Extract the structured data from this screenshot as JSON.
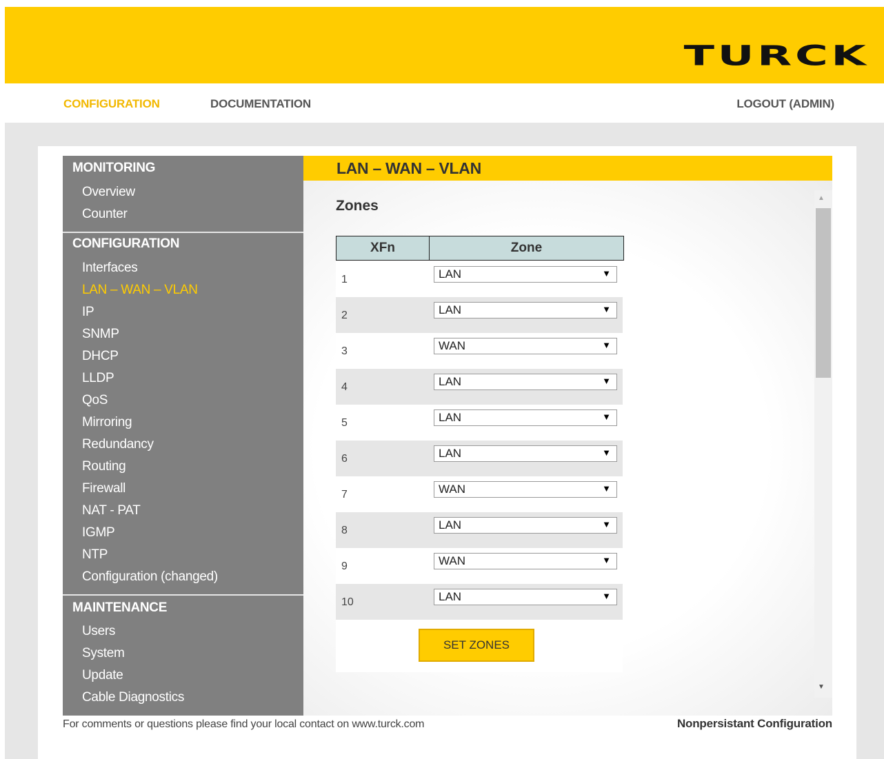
{
  "brand": {
    "logo_text": "TURCK",
    "accent_color": "#ffcc00"
  },
  "topnav": {
    "configuration": "CONFIGURATION",
    "documentation": "DOCUMENTATION",
    "logout": "LOGOUT (ADMIN)"
  },
  "sidebar": {
    "monitoring": {
      "title": "MONITORING",
      "items": [
        "Overview",
        "Counter"
      ]
    },
    "configuration": {
      "title": "CONFIGURATION",
      "items": [
        "Interfaces",
        "LAN – WAN – VLAN",
        "IP",
        "SNMP",
        "DHCP",
        "LLDP",
        "QoS",
        "Mirroring",
        "Redundancy",
        "Routing",
        "Firewall",
        "NAT - PAT",
        "IGMP",
        "NTP",
        "Configuration (changed)"
      ],
      "active": "LAN – WAN – VLAN"
    },
    "maintenance": {
      "title": "MAINTENANCE",
      "items": [
        "Users",
        "System",
        "Update",
        "Cable Diagnostics"
      ]
    }
  },
  "page": {
    "title": "LAN – WAN – VLAN",
    "section_title": "Zones"
  },
  "zones_table": {
    "headers": [
      "XFn",
      "Zone"
    ],
    "rows": [
      {
        "xfn": "1",
        "zone": "LAN"
      },
      {
        "xfn": "2",
        "zone": "LAN"
      },
      {
        "xfn": "3",
        "zone": "WAN"
      },
      {
        "xfn": "4",
        "zone": "LAN"
      },
      {
        "xfn": "5",
        "zone": "LAN"
      },
      {
        "xfn": "6",
        "zone": "LAN"
      },
      {
        "xfn": "7",
        "zone": "WAN"
      },
      {
        "xfn": "8",
        "zone": "LAN"
      },
      {
        "xfn": "9",
        "zone": "WAN"
      },
      {
        "xfn": "10",
        "zone": "LAN"
      }
    ],
    "dropdown_arrow": "▼",
    "submit_label": "SET ZONES"
  },
  "scrollbar": {
    "up_arrow": "▲",
    "down_arrow": "▼"
  },
  "footer": {
    "contact_text": "For comments or questions please find your local contact on www.turck.com",
    "status": "Nonpersistant Configuration"
  }
}
